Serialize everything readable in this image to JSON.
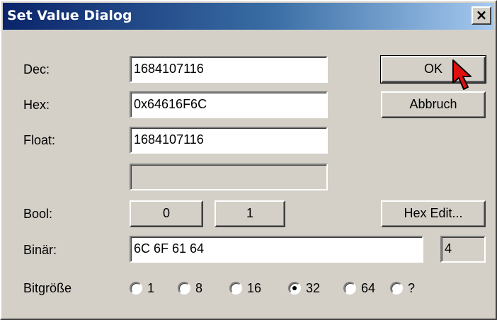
{
  "window": {
    "title": "Set Value Dialog",
    "close_glyph": "×"
  },
  "labels": {
    "dec": "Dec:",
    "hex": "Hex:",
    "float": "Float:",
    "bool": "Bool:",
    "binaer": "Binär:",
    "bitgroesse": "Bitgröße"
  },
  "fields": {
    "dec": "1684107116",
    "hex": "0x64616F6C",
    "float": "1684107116",
    "extra": "",
    "binaer": "6C 6F 61 64",
    "byte_count": "4"
  },
  "buttons": {
    "ok": "OK",
    "abbruch": "Abbruch",
    "bool_0": "0",
    "bool_1": "1",
    "hex_edit": "Hex Edit..."
  },
  "bitsize": {
    "options": [
      "1",
      "8",
      "16",
      "32",
      "64",
      "?"
    ],
    "selected": "32"
  },
  "icons": {
    "cursor": "mouse-pointer-icon",
    "close": "close-icon"
  },
  "colors": {
    "title_start": "#0a246a",
    "title_end": "#a6caf0",
    "face": "#d4d0c8",
    "cursor": "#e01010"
  }
}
